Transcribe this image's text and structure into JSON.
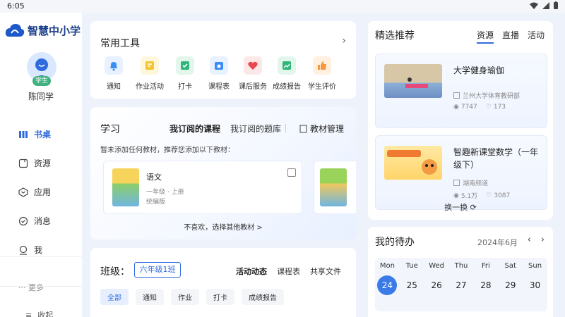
{
  "status": {
    "time": "6:05"
  },
  "app": {
    "name": "智慧中小学"
  },
  "profile": {
    "role": "学生",
    "name": "陈同学"
  },
  "nav": [
    {
      "label": "书桌",
      "icon": "desk-icon"
    },
    {
      "label": "资源",
      "icon": "resource-icon"
    },
    {
      "label": "应用",
      "icon": "apps-icon"
    },
    {
      "label": "消息",
      "icon": "message-icon"
    },
    {
      "label": "我",
      "icon": "user-icon"
    }
  ],
  "more_label": "··· 更多",
  "collapse_label": "收起",
  "tools": {
    "title": "常用工具",
    "items": [
      {
        "label": "通知",
        "icon": "bell-icon",
        "color": "#3b8ef5"
      },
      {
        "label": "作业活动",
        "icon": "homework-icon",
        "color": "#f5c531"
      },
      {
        "label": "打卡",
        "icon": "checkin-icon",
        "color": "#2fb67a"
      },
      {
        "label": "课程表",
        "icon": "schedule-icon",
        "color": "#3b8ef5"
      },
      {
        "label": "课后服务",
        "icon": "after-school-icon",
        "color": "#e8484f"
      },
      {
        "label": "成绩报告",
        "icon": "report-icon",
        "color": "#2fb67a"
      },
      {
        "label": "学生评价",
        "icon": "thumbs-up-icon",
        "color": "#f5973a"
      }
    ]
  },
  "study": {
    "title": "学习",
    "tabs": [
      "我订阅的课程",
      "我订阅的题库"
    ],
    "manage": "教材管理",
    "note": "暂未添加任何教材，推荐您添加以下教材：",
    "book": {
      "name": "语文",
      "grade": "一年级 · 上册",
      "edition": "统编版"
    },
    "reject": "不喜欢，选择其他教材 >"
  },
  "klass": {
    "title": "班级：",
    "grade": "六年级1班",
    "tabs": [
      "活动动态",
      "课程表",
      "共享文件"
    ],
    "chips": [
      "全部",
      "通知",
      "作业",
      "打卡",
      "成绩报告"
    ]
  },
  "featured": {
    "title": "精选推荐",
    "tabs": [
      "资源",
      "直播",
      "活动"
    ],
    "items": [
      {
        "title": "大学健身瑜伽",
        "source": "兰州大学体育教研部",
        "views": "7747",
        "likes": "173"
      },
      {
        "title": "智趣新课堂数学（一年级下）",
        "source": "湖南频道",
        "views": "5.1万",
        "likes": "3087"
      }
    ],
    "refresh": "换一换"
  },
  "todo": {
    "title": "我的待办",
    "year_month": "2024年6月",
    "days": [
      {
        "name": "Mon",
        "num": "24"
      },
      {
        "name": "Tue",
        "num": "25"
      },
      {
        "name": "Wed",
        "num": "26"
      },
      {
        "name": "Thu",
        "num": "27"
      },
      {
        "name": "Fri",
        "num": "28"
      },
      {
        "name": "Sat",
        "num": "29"
      },
      {
        "name": "Sun",
        "num": "30"
      }
    ]
  },
  "colors": {
    "accent": "#2f6bdd",
    "today": "#3a7be8"
  }
}
